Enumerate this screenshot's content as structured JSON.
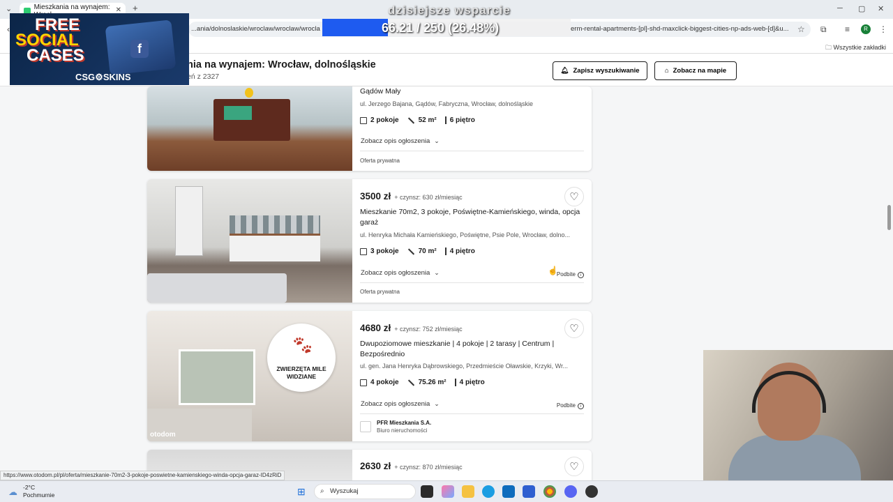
{
  "browser": {
    "tab_title": "Mieszkania na wynajem: Wrocł",
    "url_left": "...ania/dolnoslaskie/wroclaw/wroclaw/wrocla",
    "url_right": "erm-rental-apartments-[pl]-shd-maxclick-biggest-cities-np-ads-web-[d]&u...",
    "profile_initial": "R",
    "bookmarks_all": "Wszystkie zakładki"
  },
  "header": {
    "title": "nia na wynajem: Wrocław, dolnośląskie",
    "subtitle": "eń z 2327",
    "save_search": "Zapisz wyszukiwanie",
    "show_map": "Zobacz na mapie"
  },
  "listings": [
    {
      "title": "Gądów Mały",
      "address": "ul. Jerzego Bajana, Gądów, Fabryczna, Wrocław, dolnośląskie",
      "rooms": "2 pokoje",
      "area": "52 m²",
      "floor": "6 piętro",
      "desc_link": "Zobacz opis ogłoszenia",
      "offer_type": "Oferta prywatna"
    },
    {
      "price": "3500 zł",
      "rent": "+ czynsz: 630 zł/miesiąc",
      "title": "Mieszkanie 70m2, 3 pokoje, Poświętne-Kamieńskiego, winda, opcja garaż",
      "address": "ul. Henryka Michała Kamieńskiego, Poświętne, Psie Pole, Wrocław, dolno...",
      "rooms": "3 pokoje",
      "area": "70 m²",
      "floor": "4 piętro",
      "desc_link": "Zobacz opis ogłoszenia",
      "promoted": "Podbite",
      "offer_type": "Oferta prywatna"
    },
    {
      "price": "4680 zł",
      "rent": "+ czynsz: 752 zł/miesiąc",
      "title": "Dwupoziomowe mieszkanie | 4 pokoje | 2 tarasy | Centrum | Bezpośrednio",
      "address": "ul. gen. Jana Henryka Dąbrowskiego, Przedmieście Oławskie, Krzyki, Wr...",
      "rooms": "4 pokoje",
      "area": "75.26 m²",
      "floor": "4 piętro",
      "desc_link": "Zobacz opis ogłoszenia",
      "promoted": "Podbite",
      "badge_line1": "ZWIERZĘTA MILE",
      "badge_line2": "WIDZIANE",
      "watermark": "otodom",
      "agency_name": "PFR Mieszkania S.A.",
      "agency_type": "Biuro nieruchomości"
    },
    {
      "price": "2630 zł",
      "rent": "+ czynsz: 870 zł/miesiąc"
    }
  ],
  "overlay_ad": {
    "line1": "FREE",
    "line2": "SOCIAL",
    "line3": "CASES",
    "brand": "CSG⚙SKINS"
  },
  "donation": {
    "label": "dzisiejsze wsparcie",
    "progress_text": "66.21 / 250 (26.48%)",
    "progress_fraction": 0.2648
  },
  "status_url": "https://www.otodom.pl/pl/oferta/mieszkanie-70m2-3-pokoje-poswietne-kamienskiego-winda-opcja-garaz-ID4zRiD",
  "taskbar": {
    "temperature": "-2°C",
    "condition": "Pochmurnie",
    "search_placeholder": "Wyszukaj"
  },
  "colors": {
    "accent_blue": "#1e5bf0",
    "page_bg": "#f5f6f7"
  }
}
